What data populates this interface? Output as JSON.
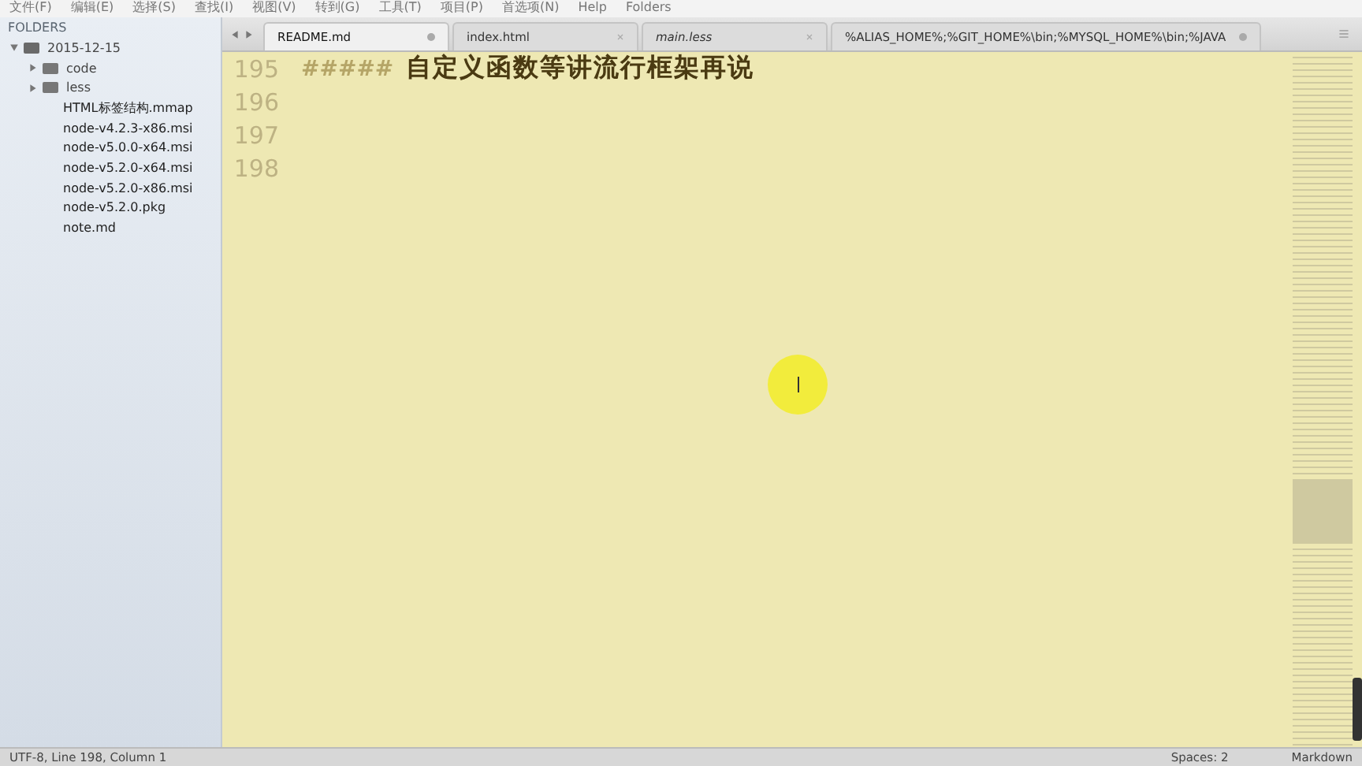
{
  "menu_bar": [
    "文件(F)",
    "编辑(E)",
    "选择(S)",
    "查找(I)",
    "视图(V)",
    "转到(G)",
    "工具(T)",
    "项目(P)",
    "首选项(N)",
    "Help",
    "Folders"
  ],
  "sidebar": {
    "title": "FOLDERS",
    "tree": [
      {
        "label": "2015-12-15",
        "kind": "folder",
        "expanded": true,
        "children": [
          {
            "label": "code",
            "kind": "folder",
            "expanded": false
          },
          {
            "label": "less",
            "kind": "folder",
            "expanded": false
          },
          {
            "label": "HTML标签结构.mmap",
            "kind": "file"
          },
          {
            "label": "node-v4.2.3-x86.msi",
            "kind": "file"
          },
          {
            "label": "node-v5.0.0-x64.msi",
            "kind": "file"
          },
          {
            "label": "node-v5.2.0-x64.msi",
            "kind": "file"
          },
          {
            "label": "node-v5.2.0-x86.msi",
            "kind": "file"
          },
          {
            "label": "node-v5.2.0.pkg",
            "kind": "file"
          },
          {
            "label": "note.md",
            "kind": "file"
          }
        ]
      }
    ]
  },
  "tabs": [
    {
      "label": "README.md",
      "selected": true,
      "modified": true,
      "italic": false
    },
    {
      "label": "index.html",
      "selected": false,
      "modified": false,
      "italic": false
    },
    {
      "label": "main.less",
      "selected": false,
      "modified": false,
      "italic": true
    },
    {
      "label": "%ALIAS_HOME%;%GIT_HOME%\\bin;%MYSQL_HOME%\\bin;%JAVA",
      "selected": false,
      "modified": true,
      "italic": false
    }
  ],
  "editor": {
    "lines": [
      {
        "number": "195",
        "marker": "#####",
        "text": "自定义函数等讲流行框架再说"
      },
      {
        "number": "196"
      },
      {
        "number": "197"
      },
      {
        "number": "198"
      }
    ]
  },
  "status_bar": {
    "position": "UTF-8, Line 198, Column 1",
    "indent": "Spaces: 2",
    "syntax": "Markdown"
  }
}
